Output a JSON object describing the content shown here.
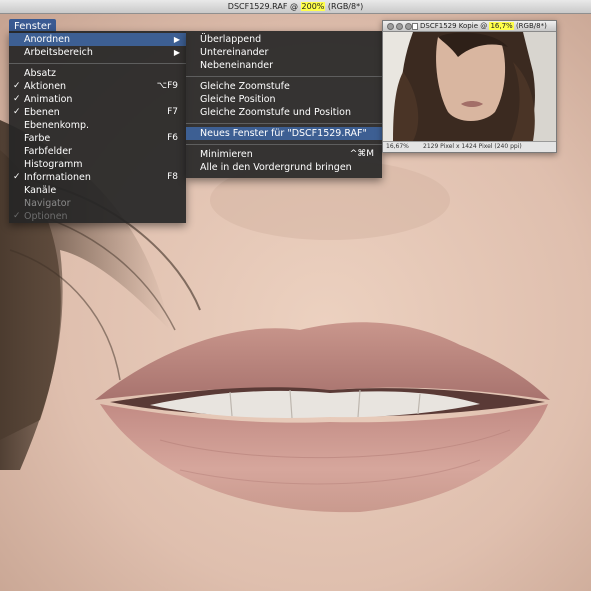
{
  "document": {
    "title_prefix": "DSCF1529.RAF @ ",
    "title_zoom": "200%",
    "title_suffix": " (RGB/8*)"
  },
  "menubar": {
    "menu_title": "Fenster"
  },
  "main_menu": {
    "items": [
      {
        "label": "Anordnen",
        "selected": true,
        "submenu": true
      },
      {
        "label": "Arbeitsbereich",
        "submenu": true
      },
      {
        "label": "Absatz"
      },
      {
        "label": "Aktionen",
        "checked": true,
        "shortcut": "⌥F9"
      },
      {
        "label": "Animation",
        "checked": true
      },
      {
        "label": "Ebenen",
        "checked": true,
        "shortcut": "F7"
      },
      {
        "label": "Ebenenkomp."
      },
      {
        "label": "Farbe",
        "shortcut": "F6"
      },
      {
        "label": "Farbfelder"
      },
      {
        "label": "Histogramm"
      },
      {
        "label": "Informationen",
        "checked": true,
        "shortcut": "F8"
      },
      {
        "label": "Kanäle"
      },
      {
        "label": "Navigator"
      },
      {
        "label": "Optionen",
        "checked": true
      }
    ],
    "check_glyph": "✓",
    "arrow_glyph": "▶"
  },
  "submenu": {
    "items": [
      {
        "label": "Überlappend"
      },
      {
        "label": "Untereinander"
      },
      {
        "label": "Nebeneinander"
      },
      {
        "label": "Gleiche Zoomstufe"
      },
      {
        "label": "Gleiche Position"
      },
      {
        "label": "Gleiche Zoomstufe und Position"
      },
      {
        "label": "Neues Fenster für \"DSCF1529.RAF\"",
        "selected": true
      },
      {
        "label": "Minimieren",
        "shortcut": "^⌘M"
      },
      {
        "label": "Alle in den Vordergrund bringen"
      }
    ]
  },
  "second_window": {
    "title_prefix": "DSCF1529 Kopie @ ",
    "title_zoom": "16,7%",
    "title_suffix": " (RGB/8*)",
    "status_zoom": "16,67%",
    "status_info": "2129 Pixel x 1424 Pixel (240 ppi)"
  },
  "colors": {
    "menu_selected": "#3d5f93",
    "menu_bg": "#262626",
    "highlight": "#ffff4a"
  }
}
